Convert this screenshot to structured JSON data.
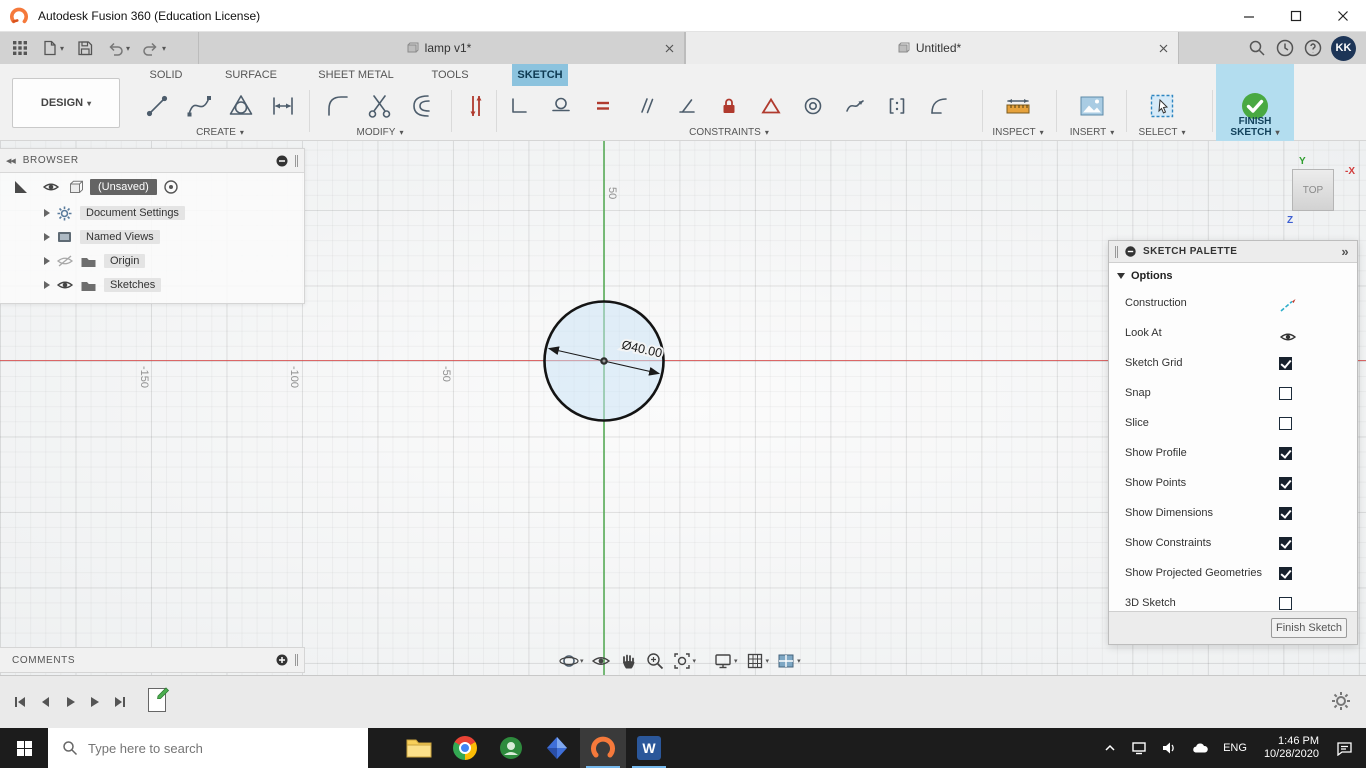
{
  "titlebar": {
    "title": "Autodesk Fusion 360 (Education License)"
  },
  "tabbar": {
    "doc_tabs": [
      {
        "label": "lamp v1*"
      },
      {
        "label": "Untitled*"
      }
    ],
    "avatar": "KK"
  },
  "ribbon": {
    "design_label": "DESIGN",
    "tabs": [
      {
        "label": "SOLID"
      },
      {
        "label": "SURFACE"
      },
      {
        "label": "SHEET METAL"
      },
      {
        "label": "TOOLS"
      },
      {
        "label": "SKETCH"
      }
    ],
    "groups": {
      "create": "CREATE",
      "modify": "MODIFY",
      "constraints": "CONSTRAINTS",
      "inspect": "INSPECT",
      "insert": "INSERT",
      "select": "SELECT",
      "finish": "FINISH SKETCH"
    }
  },
  "browser": {
    "header": "BROWSER",
    "root": "(Unsaved)",
    "items": [
      {
        "label": "Document Settings"
      },
      {
        "label": "Named Views"
      },
      {
        "label": "Origin"
      },
      {
        "label": "Sketches"
      }
    ]
  },
  "canvas": {
    "dimension": "Ø40.00",
    "x_ticks": [
      {
        "label": "-150"
      },
      {
        "label": "-100"
      },
      {
        "label": "-50"
      }
    ],
    "y_tick": "50",
    "viewcube": {
      "face": "TOP",
      "y": "Y",
      "x": "-X",
      "z": "Z"
    }
  },
  "palette": {
    "header": "SKETCH PALETTE",
    "section": "Options",
    "rows": [
      {
        "label": "Construction"
      },
      {
        "label": "Look At"
      },
      {
        "label": "Sketch Grid",
        "checked": true
      },
      {
        "label": "Snap",
        "checked": false
      },
      {
        "label": "Slice",
        "checked": false
      },
      {
        "label": "Show Profile",
        "checked": true
      },
      {
        "label": "Show Points",
        "checked": true
      },
      {
        "label": "Show Dimensions",
        "checked": true
      },
      {
        "label": "Show Constraints",
        "checked": true
      },
      {
        "label": "Show Projected Geometries",
        "checked": true
      },
      {
        "label": "3D Sketch",
        "checked": false
      }
    ],
    "finish_button": "Finish Sketch"
  },
  "comments": {
    "header": "COMMENTS"
  },
  "taskbar": {
    "search_placeholder": "Type here to search",
    "word_letter": "W",
    "tray": {
      "lang": "ENG",
      "time": "1:46 PM",
      "date": "10/28/2020"
    }
  }
}
